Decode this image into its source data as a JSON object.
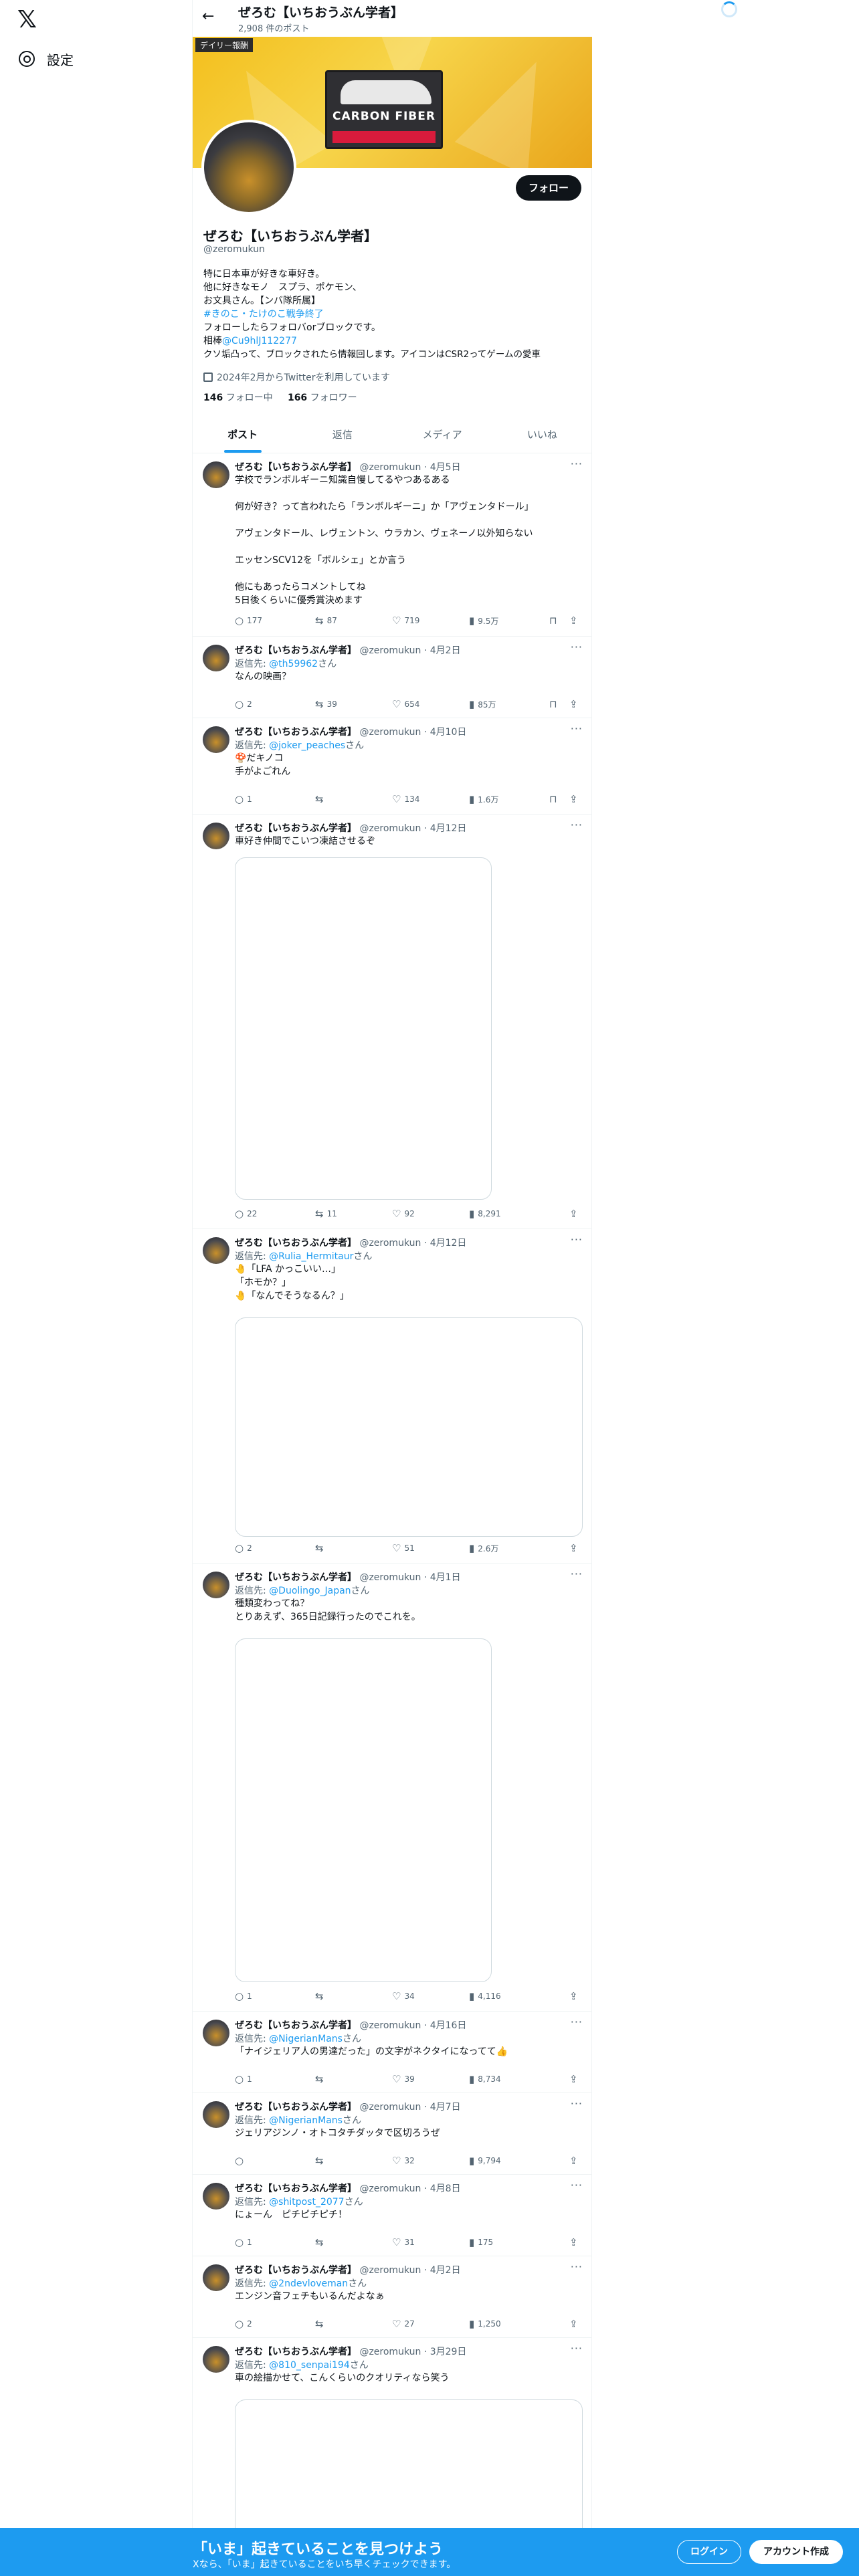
{
  "nav": {
    "settings_label": "設定"
  },
  "header": {
    "name": "ぜろむ【いちおうぶん学者】",
    "post_count": "2,908 件のポスト"
  },
  "banner": {
    "tag": "デイリー報酬",
    "pack_text": "CARBON FIBER"
  },
  "profile": {
    "follow_label": "フォロー",
    "name": "ぜろむ【いちおうぶん学者】",
    "handle": "@zeromukun",
    "bio_line1": "特に日本車が好きな車好き。",
    "bio_line2": "他に好きなモノ　スプラ、ポケモン、",
    "bio_line3": "お文具さん。【ンバ隊所属】",
    "bio_hashtag": "#きのこ・たけのこ戦争終了",
    "bio_line5": "フォローしたらフォロバorブロックです。",
    "bio_line6a": "相棒",
    "bio_line6b": "@Cu9hlJ112277",
    "bio_line7": "クソ垢凸って、ブロックされたら情報回します。アイコンはCSR2ってゲームの愛車",
    "joined": "2024年2月からTwitterを利用しています",
    "following_count": "146",
    "following_label": "フォロー中",
    "followers_count": "166",
    "followers_label": "フォロワー"
  },
  "tabs": [
    "ポスト",
    "返信",
    "メディア",
    "いいね"
  ],
  "tweets": [
    {
      "name": "ぜろむ【いちおうぶん学者】",
      "handle": "@zeromukun · 4月5日",
      "reply_prefix": "",
      "reply_to": "",
      "reply_suffix": "",
      "body": "学校でランボルギーニ知識自慢してるやつあるある\n\n何が好き？って言われたら「ランボルギーニ」か「アヴェンタドール」\n\nアヴェンタドール、レヴェントン、ウラカン、ヴェネーノ以外知らない\n\nエッセンSCV12を「ボルシェ」とか言う\n\n他にもあったらコメントしてね\n5日後くらいに優秀賞決めます",
      "replies": "177",
      "retweets": "87",
      "likes": "719",
      "views": "9.5万"
    },
    {
      "name": "ぜろむ【いちおうぶん学者】",
      "handle": "@zeromukun · 4月2日",
      "reply_prefix": "返信先: ",
      "reply_to": "@th59962",
      "reply_suffix": "さん",
      "body": "なんの映画？",
      "replies": "2",
      "retweets": "39",
      "likes": "654",
      "views": "85万"
    },
    {
      "name": "ぜろむ【いちおうぶん学者】",
      "handle": "@zeromukun · 4月10日",
      "reply_prefix": "返信先: ",
      "reply_to": "@joker_peaches",
      "reply_suffix": "さん",
      "body": "🍄だキノコ\n手がよごれん",
      "replies": "1",
      "retweets": "",
      "likes": "134",
      "views": "1.6万"
    },
    {
      "name": "ぜろむ【いちおうぶん学者】",
      "handle": "@zeromukun · 4月12日",
      "reply_prefix": "",
      "reply_to": "",
      "reply_suffix": "",
      "body": "車好き仲間でこいつ凍結させるぞ",
      "replies": "22",
      "retweets": "11",
      "likes": "92",
      "views": "8,291"
    },
    {
      "name": "ぜろむ【いちおうぶん学者】",
      "handle": "@zeromukun · 4月12日",
      "reply_prefix": "返信先: ",
      "reply_to": "@Rulia_Hermitaur",
      "reply_suffix": "さん",
      "body": "🤚「LFA かっこいい…」\n「ホモか？」\n🤚「なんでそうなるん？」",
      "replies": "2",
      "retweets": "",
      "likes": "51",
      "views": "2.6万"
    },
    {
      "name": "ぜろむ【いちおうぶん学者】",
      "handle": "@zeromukun · 4月1日",
      "reply_prefix": "返信先: ",
      "reply_to": "@Duolingo_Japan",
      "reply_suffix": "さん",
      "body": "種類変わってね？\nとりあえず、365日記録行ったのでこれを。",
      "replies": "1",
      "retweets": "",
      "likes": "34",
      "views": "4,116"
    },
    {
      "name": "ぜろむ【いちおうぶん学者】",
      "handle": "@zeromukun · 4月16日",
      "reply_prefix": "返信先: ",
      "reply_to": "@NigerianMans",
      "reply_suffix": "さん",
      "body": "「ナイジェリア人の男達だった」の文字がネクタイになってて👍",
      "replies": "1",
      "retweets": "",
      "likes": "39",
      "views": "8,734"
    },
    {
      "name": "ぜろむ【いちおうぶん学者】",
      "handle": "@zeromukun · 4月7日",
      "reply_prefix": "返信先: ",
      "reply_to": "@NigerianMans",
      "reply_suffix": "さん",
      "body": "ジェリアジンノ・オトコタチダッタで区切ろうぜ",
      "replies": "",
      "retweets": "",
      "likes": "32",
      "views": "9,794"
    },
    {
      "name": "ぜろむ【いちおうぶん学者】",
      "handle": "@zeromukun · 4月8日",
      "reply_prefix": "返信先: ",
      "reply_to": "@shitpost_2077",
      "reply_suffix": "さん",
      "body": "にょーん　ピチピチピチ！",
      "replies": "1",
      "retweets": "",
      "likes": "31",
      "views": "175"
    },
    {
      "name": "ぜろむ【いちおうぶん学者】",
      "handle": "@zeromukun · 4月2日",
      "reply_prefix": "返信先: ",
      "reply_to": "@2ndevloveman",
      "reply_suffix": "さん",
      "body": "エンジン音フェチもいるんだよなぁ",
      "replies": "2",
      "retweets": "",
      "likes": "27",
      "views": "1,250"
    },
    {
      "name": "ぜろむ【いちおうぶん学者】",
      "handle": "@zeromukun · 3月29日",
      "reply_prefix": "返信先: ",
      "reply_to": "@810_senpai194",
      "reply_suffix": "さん",
      "body": "車の絵描かせて、こんくらいのクオリティなら笑う",
      "replies": "",
      "retweets": "",
      "likes": "",
      "views": ""
    }
  ],
  "bottom": {
    "title": "「いま」起きていることを見つけよう",
    "subtitle": "Xなら、「いま」起きていることをいち早くチェックできます。",
    "login": "ログイン",
    "signup": "アカウント作成"
  },
  "colors": {
    "accent": "#1d9bf0",
    "text": "#0f1419",
    "muted": "#536471"
  }
}
